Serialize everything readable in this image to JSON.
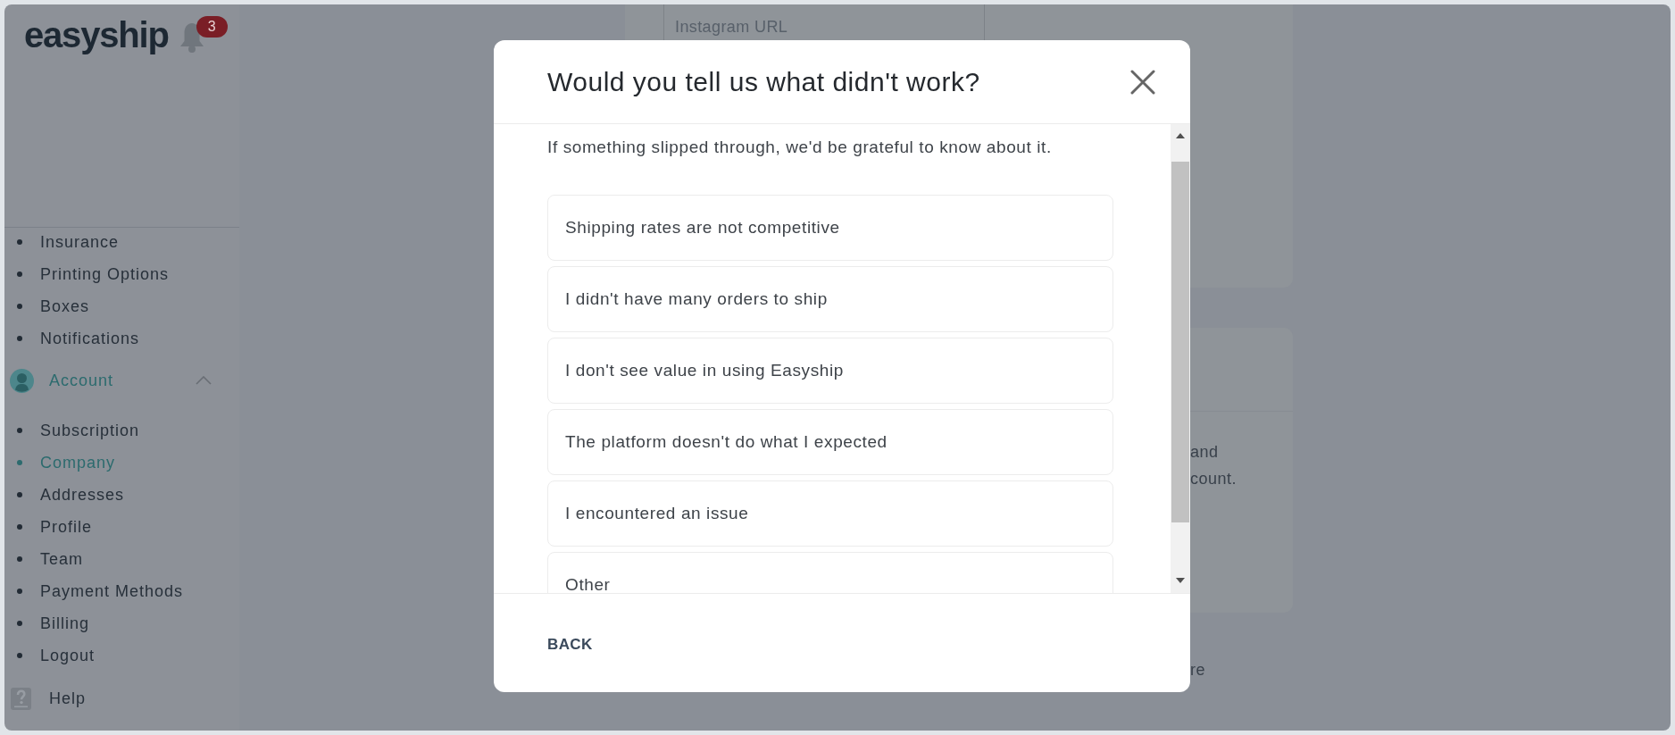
{
  "sidebar": {
    "logo": "easyship",
    "notification_count": "3",
    "settings_items": [
      {
        "label": "Insurance",
        "selected": false
      },
      {
        "label": "Printing Options",
        "selected": false
      },
      {
        "label": "Boxes",
        "selected": false
      },
      {
        "label": "Notifications",
        "selected": false
      }
    ],
    "account": {
      "label": "Account",
      "expanded": true,
      "items": [
        {
          "label": "Subscription",
          "selected": false
        },
        {
          "label": "Company",
          "selected": true
        },
        {
          "label": "Addresses",
          "selected": false
        },
        {
          "label": "Profile",
          "selected": false
        },
        {
          "label": "Team",
          "selected": false
        },
        {
          "label": "Payment Methods",
          "selected": false
        },
        {
          "label": "Billing",
          "selected": false
        },
        {
          "label": "Logout",
          "selected": false
        }
      ]
    },
    "help": "Help"
  },
  "page": {
    "instagram_field": {
      "placeholder": "Instagram URL"
    },
    "card_text": [
      "and",
      "count."
    ],
    "footer_text": "re"
  },
  "modal": {
    "title": "Would you tell us what didn't work?",
    "subtitle": "If something slipped through, we'd be grateful to know about it.",
    "options": [
      {
        "label": "Shipping rates are not competitive",
        "selected": false
      },
      {
        "label": "I didn't have many orders to ship",
        "selected": false
      },
      {
        "label": "I don't see value in using Easyship",
        "selected": false
      },
      {
        "label": "The platform doesn't do what I expected",
        "selected": false
      },
      {
        "label": "I encountered an issue",
        "selected": false
      },
      {
        "label": "Other",
        "selected": false
      }
    ],
    "back_button": "BACK"
  }
}
